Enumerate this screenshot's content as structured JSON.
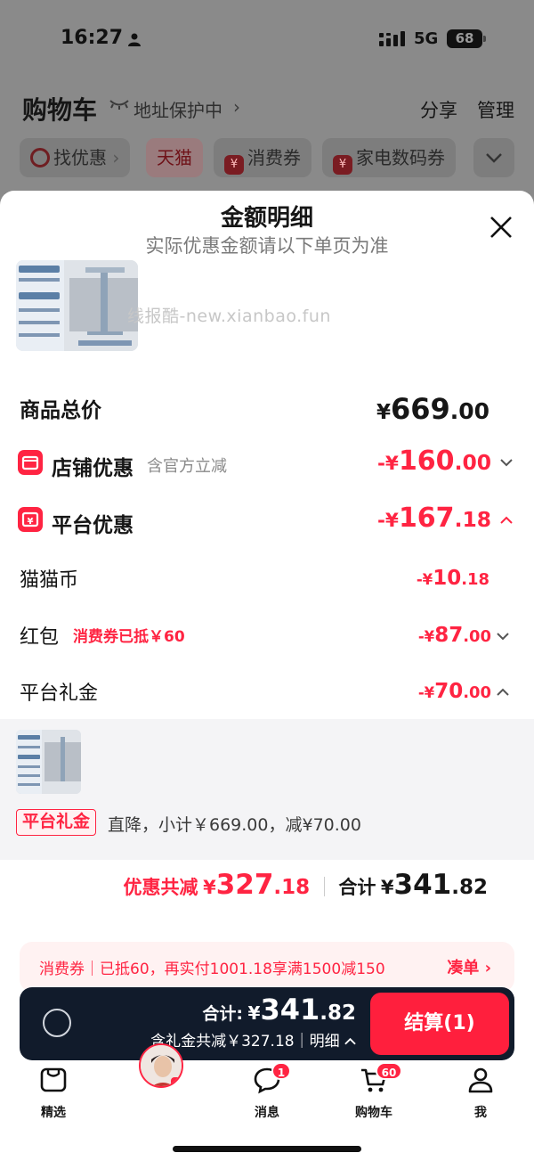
{
  "status_bar": {
    "time": "16:27",
    "network": "5G",
    "battery": "68"
  },
  "cart_header": {
    "title": "购物车",
    "address_text": "地址保护中",
    "share": "分享",
    "manage": "管理"
  },
  "filter_chips": [
    "找优惠",
    "天猫",
    "消费券",
    "家电数码券"
  ],
  "sheet": {
    "title": "金额明细",
    "subtitle": "实际优惠金额请以下单页为准",
    "rows": {
      "total": {
        "label": "商品总价",
        "currency": "¥",
        "int": "669",
        "dec": ".00"
      },
      "store": {
        "label": "店铺优惠",
        "note": "含官方立减",
        "currency": "-¥",
        "int": "160",
        "dec": ".00"
      },
      "platform": {
        "label": "平台优惠",
        "currency": "-¥",
        "int": "167",
        "dec": ".18"
      },
      "maomao": {
        "label": "猫猫币",
        "currency": "-¥",
        "int": "10",
        "dec": ".18"
      },
      "hongbao": {
        "label": "红包",
        "note": "消费券已抵￥60",
        "currency": "-¥",
        "int": "87",
        "dec": ".00"
      },
      "gift": {
        "label": "平台礼金",
        "currency": "-¥",
        "int": "70",
        "dec": ".00"
      }
    },
    "gift_detail": {
      "tag": "平台礼金",
      "desc": "直降，小计￥669.00，减¥70.00"
    },
    "summary": {
      "discount_label": "优惠共减",
      "discount_currency": "¥",
      "discount_int": "327",
      "discount_dec": ".18",
      "total_label": "合计",
      "total_currency": "¥",
      "total_int": "341",
      "total_dec": ".82"
    }
  },
  "watermark": "线报酷-new.xianbao.fun",
  "coupon_tip": {
    "text": "消费券｜已抵60，再实付1001.18享满1500减150",
    "link": "凑单"
  },
  "checkout": {
    "total_label": "合计:",
    "currency": "¥",
    "int": "341",
    "dec": ".82",
    "sub": "含礼金共减￥327.18｜明细",
    "button": "结算(1)"
  },
  "tabs": [
    {
      "label": "精选"
    },
    {
      "label": ""
    },
    {
      "label": "消息",
      "badge": "1"
    },
    {
      "label": "购物车",
      "badge": "60"
    },
    {
      "label": "我"
    }
  ],
  "colors": {
    "accent": "#ff2442",
    "checkout_bar": "#111b2b"
  }
}
